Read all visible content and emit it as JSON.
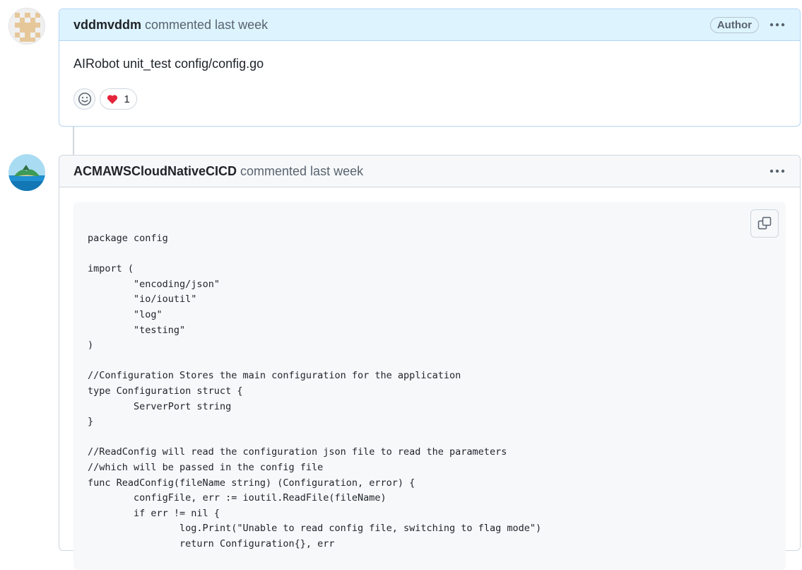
{
  "comments": [
    {
      "author": "vddmvddm",
      "meta": "commented last week",
      "badge": "Author",
      "body": "AIRobot unit_test config/config.go",
      "reactions": {
        "heart_count": "1"
      }
    },
    {
      "author": "ACMAWSCloudNativeCICD",
      "meta": "commented last week",
      "code_lines": [
        "package config",
        "",
        "import (",
        "\t\"encoding/json\"",
        "\t\"io/ioutil\"",
        "\t\"log\"",
        "\t\"testing\"",
        ")",
        "",
        "//Configuration Stores the main configuration for the application",
        "type Configuration struct {",
        "\tServerPort string",
        "}",
        "",
        "//ReadConfig will read the configuration json file to read the parameters",
        "//which will be passed in the config file",
        "func ReadConfig(fileName string) (Configuration, error) {",
        "\tconfigFile, err := ioutil.ReadFile(fileName)",
        "\tif err != nil {",
        "\t\tlog.Print(\"Unable to read config file, switching to flag mode\")",
        "\t\treturn Configuration{}, err"
      ]
    }
  ],
  "icons": {
    "kebab": "kebab-horizontal-icon",
    "smiley": "smiley-icon",
    "heart": "heart-icon",
    "copy": "copy-icon"
  },
  "colors": {
    "author_header_bg": "#ddf4ff",
    "author_border": "#b6d6f4",
    "header_bg": "#f6f8fa",
    "border": "#d0d7de",
    "heart": "#e5243b"
  }
}
